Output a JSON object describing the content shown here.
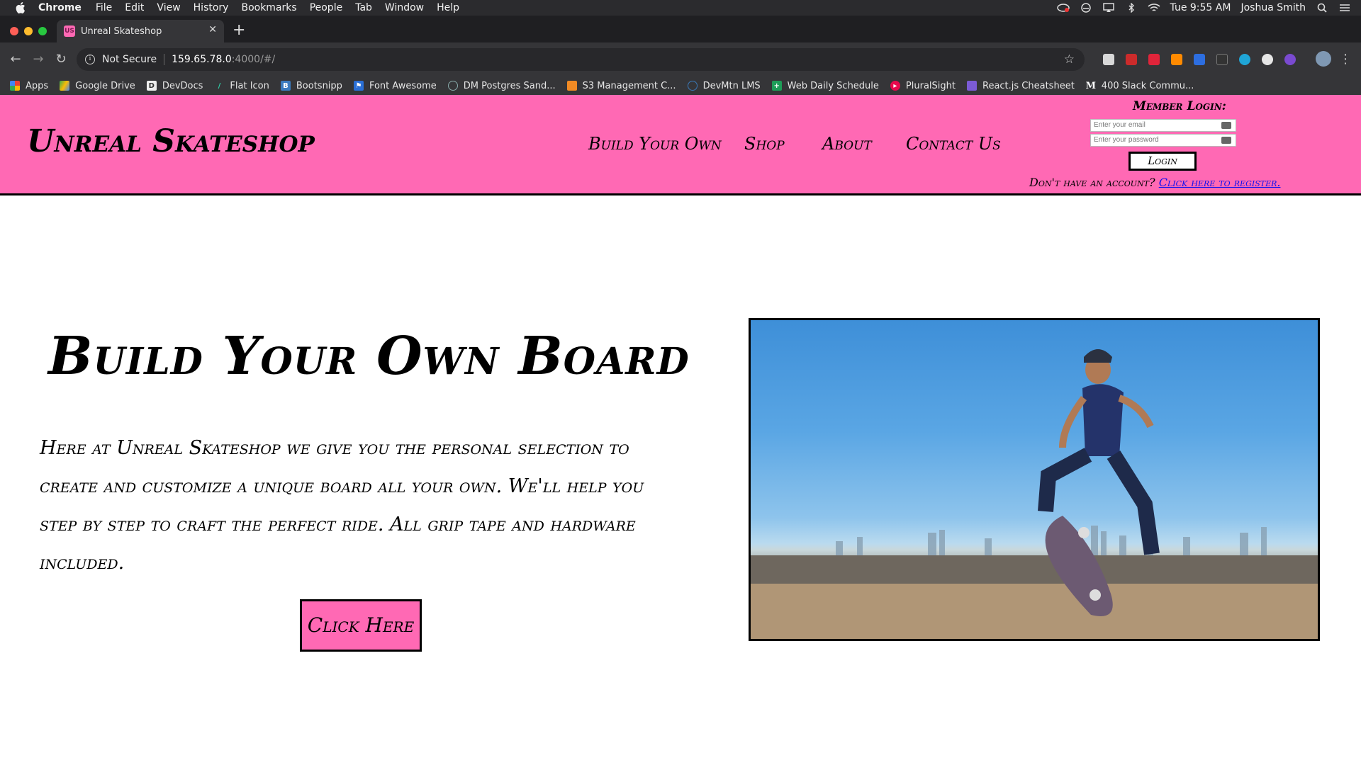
{
  "menubar": {
    "app": "Chrome",
    "items": [
      "File",
      "Edit",
      "View",
      "History",
      "Bookmarks",
      "People",
      "Tab",
      "Window",
      "Help"
    ],
    "clock": "Tue 9:55 AM",
    "user": "Joshua Smith"
  },
  "browser": {
    "tab_title": "Unreal Skateshop",
    "tab_favicon": "US",
    "security_label": "Not Secure",
    "url_host": "159.65.78.0",
    "url_path": ":4000/#/"
  },
  "bookmarks": [
    {
      "label": "Apps",
      "icon": "apps-grid-icon"
    },
    {
      "label": "Google Drive",
      "icon": "google-drive-icon"
    },
    {
      "label": "DevDocs",
      "icon": "devdocs-icon"
    },
    {
      "label": "Flat Icon",
      "icon": "flaticon-icon"
    },
    {
      "label": "Bootsnipp",
      "icon": "bootsnipp-icon"
    },
    {
      "label": "Font Awesome",
      "icon": "font-awesome-icon"
    },
    {
      "label": "DM Postgres Sand...",
      "icon": "postgres-icon"
    },
    {
      "label": "S3 Management C...",
      "icon": "aws-s3-icon"
    },
    {
      "label": "DevMtn LMS",
      "icon": "devmtn-icon"
    },
    {
      "label": "Web Daily Schedule",
      "icon": "sheets-icon"
    },
    {
      "label": "PluralSight",
      "icon": "pluralsight-icon"
    },
    {
      "label": "React.js Cheatsheet",
      "icon": "react-icon"
    },
    {
      "label": "400 Slack Commu...",
      "icon": "medium-icon"
    }
  ],
  "site": {
    "logo": "Unreal Skateshop",
    "nav": [
      "Build Your Own",
      "Shop",
      "About",
      "Contact Us"
    ],
    "login": {
      "title": "Member Login:",
      "email_placeholder": "Enter your email",
      "password_placeholder": "Enter your password",
      "button": "Login",
      "register_prompt": "Don't have an account?",
      "register_link": "Click here to register."
    },
    "hero": {
      "title": "Build Your Own Board",
      "text": "Here at Unreal Skateshop we give you the personal selection to create and customize a unique board all your own. We'll help you step by step to craft the perfect ride. All grip tape and hardware included.",
      "cta": "Click Here"
    }
  },
  "colors": {
    "brand_pink": "#ff69b4",
    "link_blue": "#1010ee"
  }
}
